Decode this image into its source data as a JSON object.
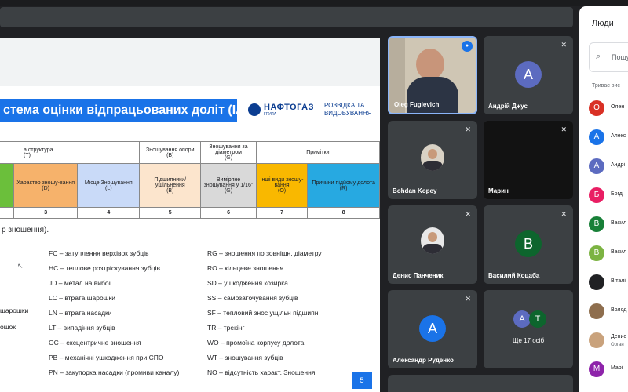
{
  "slide": {
    "title": "стема оцінки відпрацьованих доліт (IADC)",
    "logo_main": "НАФТОГАЗ",
    "logo_sub": "ГРУПА",
    "logo_right_1": "РОЗВІДКА ТА",
    "logo_right_2": "ВИДОБУВАННЯ",
    "table": {
      "h_structure": "а структура",
      "h_structure_code": "(T)",
      "h_bearing": "Зношування опори",
      "h_bearing_code": "(B)",
      "h_gauge": "Зношування за діаметром",
      "h_gauge_code": "(G)",
      "h_notes": "Примітки",
      "c_char": "Характер зношу-вання",
      "c_char_code": "(D)",
      "c_loc": "Місце Зношування",
      "c_loc_code": "(L)",
      "c_seal": "Підшипники/ ущільнення",
      "c_seal_code": "(B)",
      "c_gauge": "Виміряне зношування у 1/16\"",
      "c_gauge_code": "(G)",
      "c_other": "Інші види зношу-вання",
      "c_other_code": "(O)",
      "c_reason": "Причини підйому долота",
      "c_reason_code": "(R)",
      "nums": [
        "3",
        "4",
        "5",
        "6",
        "7",
        "8"
      ]
    },
    "caption": "р зношення).",
    "legend_left": [
      "шарошки",
      "ошок"
    ],
    "legend_mid": [
      "FC – затуплення верхівок зубців",
      "HC – теплове розтріскування зубців",
      "JD – метал на вибої",
      "LC – втрата шарошки",
      "LN – втрата насадки",
      "LT – випадіння зубців",
      "OC – ексцентричне зношення",
      "PB – механічні ушкодження при СПО",
      "PN – закупорка насадки (промиви каналу)"
    ],
    "legend_right": [
      "RG – зношення по зовнішн. діаметру",
      "RO – кільцеве зношення",
      "SD – ушкодження козирка",
      "SS – самозаточування зубців",
      "SF – тепловий знос ущільн підшипн.",
      "TR – трекінг",
      "WO – промоїна корпусу долота",
      "WT – зношування зубців",
      "NO – відсутність характ. Зношення"
    ],
    "page_number": "5"
  },
  "tiles": [
    {
      "name": "Oleg Fuglevich",
      "type": "video"
    },
    {
      "name": "Андрій Джус",
      "initial": "A",
      "color": "#5c6bc0"
    },
    {
      "name": "Bohdan Kopey",
      "type": "photo"
    },
    {
      "name": "Марин",
      "type": "empty"
    },
    {
      "name": "Денис Панченик",
      "type": "photo"
    },
    {
      "name": "Василий Коцаба",
      "initial": "B",
      "color": "#0d652d"
    },
    {
      "name": "Александр Руденко",
      "initial": "A",
      "color": "#1a73e8"
    },
    {
      "name": "Ще 17 осіб",
      "initials": [
        "A",
        "T"
      ]
    }
  ],
  "people_panel": {
    "title": "Люди",
    "search_placeholder": "Пошук",
    "section_label": "Триває вис",
    "people": [
      {
        "initial": "O",
        "name": "Олен",
        "color": "#d93025"
      },
      {
        "initial": "A",
        "name": "Алекс",
        "color": "#1a73e8"
      },
      {
        "initial": "A",
        "name": "Андрі",
        "color": "#5c6bc0"
      },
      {
        "initial": "Б",
        "name": "Богд",
        "color": "#e91e63"
      },
      {
        "initial": "B",
        "name": "Васил",
        "color": "#188038"
      },
      {
        "initial": "B",
        "name": "Васил",
        "color": "#7cb342"
      },
      {
        "initial": "",
        "name": "Віталі",
        "color": "#202124"
      },
      {
        "initial": "",
        "name": "Волод",
        "color": "#8e6e4e"
      },
      {
        "initial": "",
        "name": "Денис",
        "sub": "Орган",
        "color": "#c9a27c"
      },
      {
        "initial": "M",
        "name": "Марі",
        "color": "#8e24aa"
      }
    ]
  }
}
